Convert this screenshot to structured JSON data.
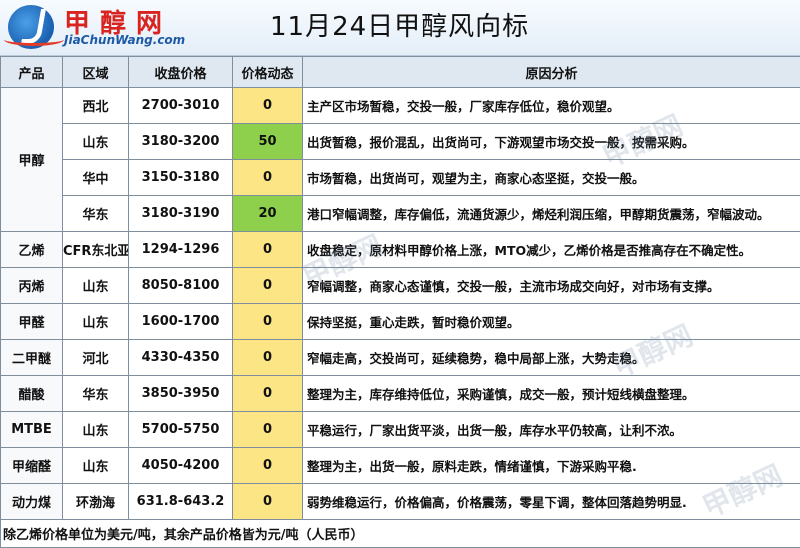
{
  "header": {
    "logo_cn": "甲醇网",
    "logo_en": "JiaChunWang.com",
    "title": "11月24日甲醇风向标"
  },
  "table": {
    "columns": [
      "产品",
      "区域",
      "收盘价格",
      "价格动态",
      "原因分析"
    ],
    "rows": [
      {
        "region": "西北",
        "price": "2700-3010",
        "change": "0",
        "reason": "主产区市场暂稳，交投一般，厂家库存低位，稳价观望。"
      },
      {
        "region": "山东",
        "price": "3180-3200",
        "change": "50",
        "reason": "出货暂稳，报价混乱，出货尚可，下游观望市场交投一般，按需采购。"
      },
      {
        "region": "华中",
        "price": "3150-3180",
        "change": "0",
        "reason": "市场暂稳，出货尚可，观望为主，商家心态坚挺，交投一般。"
      },
      {
        "region": "华东",
        "price": "3180-3190",
        "change": "20",
        "reason": "港口窄幅调整，库存偏低，流通货源少，烯烃利润压缩，甲醇期货震荡，窄幅波动。"
      },
      {
        "product": "乙烯",
        "region": "CFR东北亚",
        "price": "1294-1296",
        "change": "0",
        "reason": "收盘稳定，原材料甲醇价格上涨，MTO减少，乙烯价格是否推高存在不确定性。"
      },
      {
        "product": "丙烯",
        "region": "山东",
        "price": "8050-8100",
        "change": "0",
        "reason": "窄幅调整，商家心态谨慎，交投一般，主流市场成交向好，对市场有支撑。"
      },
      {
        "product": "甲醛",
        "region": "山东",
        "price": "1600-1700",
        "change": "0",
        "reason": "保持坚挺，重心走跌，暂时稳价观望。"
      },
      {
        "product": "二甲醚",
        "region": "河北",
        "price": "4330-4350",
        "change": "0",
        "reason": "窄幅走高，交投尚可，延续稳势，稳中局部上涨，大势走稳。"
      },
      {
        "product": "醋酸",
        "region": "华东",
        "price": "3850-3950",
        "change": "0",
        "reason": "整理为主，库存维持低位，采购谨慎，成交一般，预计短线横盘整理。"
      },
      {
        "product": "MTBE",
        "region": "山东",
        "price": "5700-5750",
        "change": "0",
        "reason": "平稳运行，厂家出货平淡，出货一般，库存水平仍较高，让利不浓。"
      },
      {
        "product": "甲缩醛",
        "region": "山东",
        "price": "4050-4200",
        "change": "0",
        "reason": "整理为主，出货一般，原料走跌，情绪谨慎，下游采购平稳."
      },
      {
        "product": "动力煤",
        "region": "环渤海",
        "price": "631.8-643.2",
        "change": "0",
        "reason": "弱势维稳运行，价格偏高，价格震荡，零星下调，整体回落趋势明显."
      }
    ],
    "group_product": "甲醇",
    "note": "除乙烯价格单位为美元/吨，其余产品价格皆为元/吨（人民币）"
  },
  "watermark": "甲醇网",
  "colors": {
    "change_flat": "#fbe584",
    "change_up": "#8ed04c",
    "header_bg": "#dfe8f1",
    "title_red": "#d8231f"
  }
}
